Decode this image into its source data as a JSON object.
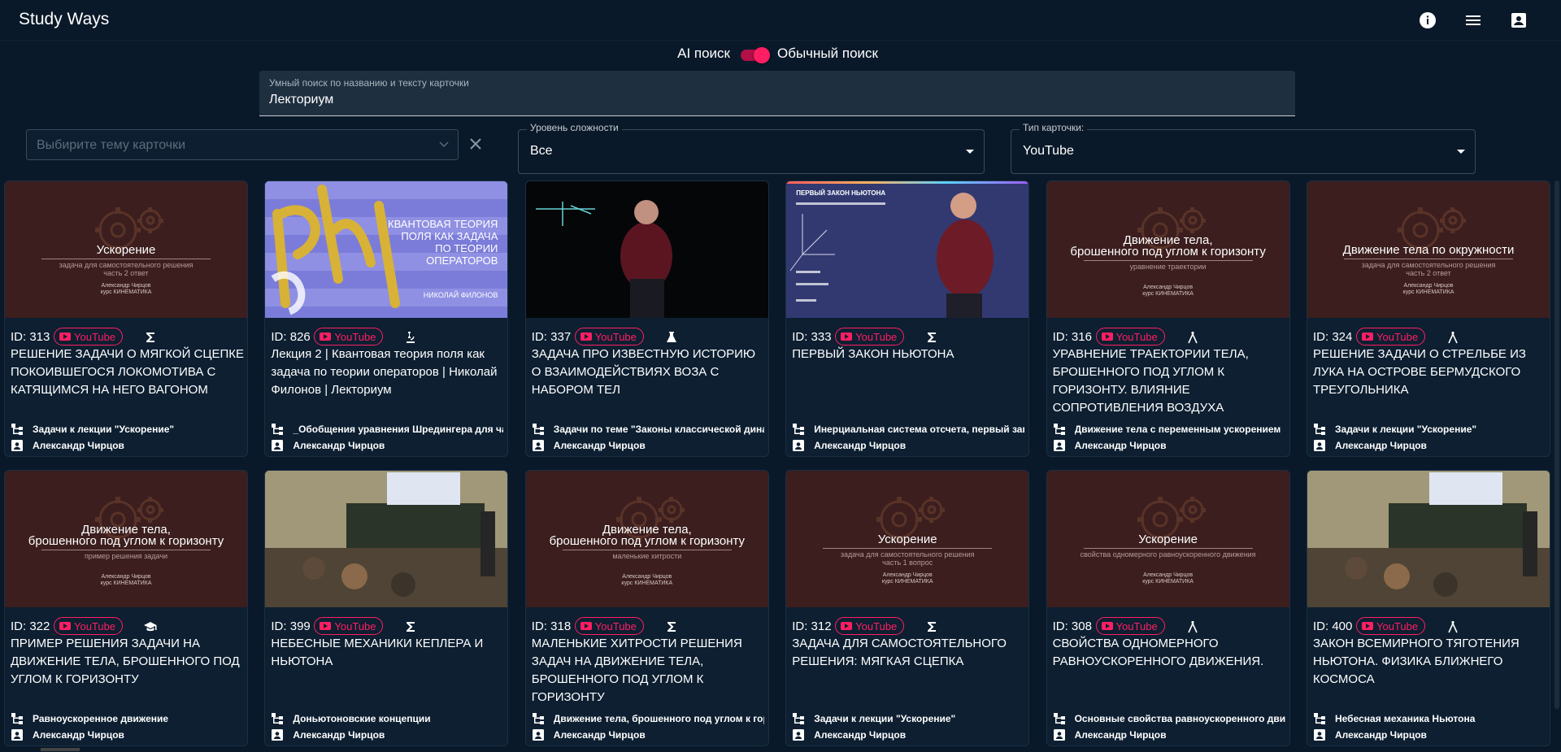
{
  "app": {
    "title": "Study Ways"
  },
  "header": {
    "icons": [
      "info-icon",
      "menu-icon",
      "account-icon"
    ]
  },
  "search_mode": {
    "left_label": "AI поиск",
    "right_label": "Обычный поиск",
    "checked": true
  },
  "search": {
    "label": "Умный поиск по названию и тексту карточки",
    "value": "Лекториум"
  },
  "filters": {
    "topic": {
      "placeholder": "Выбирите тему карточки"
    },
    "difficulty": {
      "label": "Уровень сложности",
      "value": "Все"
    },
    "card_type": {
      "label": "Тип карточки:",
      "value": "YouTube"
    }
  },
  "badge_label": "YouTube",
  "colors": {
    "accent": "#ff1e62",
    "background": "#0a1929",
    "card": "#0d1f31",
    "thumb_brown": "#3c1e1e"
  },
  "cards": [
    {
      "id": "ID: 313",
      "type_icon": "sigma-icon",
      "title": "РЕШЕНИЕ ЗАДАЧИ О МЯГКОЙ СЦЕПКЕ ПОКОИВШЕГОСЯ ЛОКОМОТИВА С КАТЯЩИМСЯ НА НЕГО ВАГОНОМ",
      "topic": "Задачи к лекции \"Ускорение\"",
      "author": "Александр Чирцов",
      "thumb": {
        "style": "gear",
        "title": "Ускорение",
        "subtitle": "задача для самостоятельного решения\nчасть 2 ответ",
        "author": "Александр Чирцов\nкурс КИНЕМАТИКА"
      }
    },
    {
      "id": "ID: 826",
      "type_icon": "microscope-icon",
      "title": "Лекция 2 | Квантовая теория поля как задача по теории операторов | Николай Филонов | Лекториум",
      "topic": "_Обобщения уравнения Шредингера для частиц",
      "author": "Александр Чирцов",
      "thumb": {
        "style": "quantum",
        "title": "КВАНТОВАЯ ТЕОРИЯ\nПОЛЯ КАК ЗАДАЧА\nПО ТЕОРИИ\nОПЕРАТОРОВ",
        "subtitle": "",
        "author": "НИКОЛАЙ ФИЛОНОВ"
      }
    },
    {
      "id": "ID: 337",
      "type_icon": "flask-icon",
      "title": "ЗАДАЧА ПРО ИЗВЕСТНУЮ ИСТОРИЮ О ВЗАИМОДЕЙСТВИЯХ ВОЗА С НАБОРОМ ТЕЛ",
      "topic": "Задачи по теме \"Законы классической динамики\"",
      "author": "Александр Чирцов",
      "thumb": {
        "style": "dark",
        "title": "",
        "subtitle": "",
        "author": ""
      }
    },
    {
      "id": "ID: 333",
      "type_icon": "sigma-icon",
      "title": "ПЕРВЫЙ ЗАКОН НЬЮТОНА",
      "topic": "Инерциальная система отсчета, первый закон Ньютона",
      "author": "Александр Чирцов",
      "thumb": {
        "style": "blue",
        "title": "ПЕРВЫЙ ЗАКОН НЬЮТОНА",
        "subtitle": "",
        "author": ""
      }
    },
    {
      "id": "ID: 316",
      "type_icon": "compass-icon",
      "title": "УРАВНЕНИЕ ТРАЕКТОРИИ ТЕЛА, БРОШЕННОГО ПОД УГЛОМ К ГОРИЗОНТУ. ВЛИЯНИЕ СОПРОТИВЛЕНИЯ ВОЗДУХА",
      "topic": "Движение тела с переменным ускорением",
      "author": "Александр Чирцов",
      "thumb": {
        "style": "gear",
        "title": "Движение тела,\nброшенного под углом к горизонту",
        "subtitle": "уравнение траектории",
        "author": "Александр Чирцов\nкурс КИНЕМАТИКА"
      }
    },
    {
      "id": "ID: 324",
      "type_icon": "compass-icon",
      "title": "РЕШЕНИЕ ЗАДАЧИ О СТРЕЛЬБЕ ИЗ ЛУКА НА ОСТРОВЕ БЕРМУДСКОГО ТРЕУГОЛЬНИКА",
      "topic": "Задачи к лекции \"Ускорение\"",
      "author": "Александр Чирцов",
      "thumb": {
        "style": "gear",
        "title": "Движение тела по окружности",
        "subtitle": "задача для самостоятельного решения\nчасть 2 ответ",
        "author": "Александр Чирцов\nкурс КИНЕМАТИКА"
      }
    },
    {
      "id": "ID: 322",
      "type_icon": "graduation-cap-icon",
      "title": "ПРИМЕР РЕШЕНИЯ ЗАДАЧИ НА ДВИЖЕНИЕ ТЕЛА, БРОШЕННОГО ПОД УГЛОМ К ГОРИЗОНТУ",
      "topic": "Равноускоренное движение",
      "author": "Александр Чирцов",
      "thumb": {
        "style": "gear",
        "title": "Движение тела,\nброшенного под углом к горизонту",
        "subtitle": "пример решения задачи",
        "author": "Александр Чирцов\nкурс КИНЕМАТИКА"
      }
    },
    {
      "id": "ID: 399",
      "type_icon": "sigma-icon",
      "title": "НЕБЕСНЫЕ МЕХАНИКИ КЕПЛЕРА И НЬЮТОНА",
      "topic": "Доньютоновские концепции",
      "author": "Александр Чирцов",
      "thumb": {
        "style": "classroom",
        "title": "",
        "subtitle": "",
        "author": ""
      }
    },
    {
      "id": "ID: 318",
      "type_icon": "sigma-icon",
      "title": "МАЛЕНЬКИЕ ХИТРОСТИ РЕШЕНИЯ ЗАДАЧ НА ДВИЖЕНИЕ ТЕЛА, БРОШЕННОГО ПОД УГЛОМ К ГОРИЗОНТУ",
      "topic": "Движение тела, брошенного под углом к горизонту",
      "author": "Александр Чирцов",
      "thumb": {
        "style": "gear",
        "title": "Движение тела,\nброшенного под углом к горизонту",
        "subtitle": "маленькие хитрости",
        "author": "Александр Чирцов\nкурс КИНЕМАТИКА"
      }
    },
    {
      "id": "ID: 312",
      "type_icon": "sigma-icon",
      "title": "ЗАДАЧА ДЛЯ САМОСТОЯТЕЛЬНОГО РЕШЕНИЯ: МЯГКАЯ СЦЕПКА",
      "topic": "Задачи к лекции \"Ускорение\"",
      "author": "Александр Чирцов",
      "thumb": {
        "style": "gear",
        "title": "Ускорение",
        "subtitle": "задача для самостоятельного решения\nчасть 1 вопрос",
        "author": "Александр Чирцов\nкурс КИНЕМАТИКА"
      }
    },
    {
      "id": "ID: 308",
      "type_icon": "compass-icon",
      "title": "СВОЙСТВА ОДНОМЕРНОГО РАВНОУСКОРЕННОГО ДВИЖЕНИЯ.",
      "topic": "Основные свойства равноускоренного движения",
      "author": "Александр Чирцов",
      "thumb": {
        "style": "gear",
        "title": "Ускорение",
        "subtitle": "свойства одномерного равноускоренного движения",
        "author": "Александр Чирцов\nкурс КИНЕМАТИКА"
      }
    },
    {
      "id": "ID: 400",
      "type_icon": "compass-icon",
      "title": "ЗАКОН ВСЕМИРНОГО ТЯГОТЕНИЯ НЬЮТОНА. ФИЗИКА БЛИЖНЕГО КОСМОСА",
      "topic": "Небесная механика Ньютона",
      "author": "Александр Чирцов",
      "thumb": {
        "style": "classroom",
        "title": "",
        "subtitle": "",
        "author": ""
      }
    }
  ]
}
